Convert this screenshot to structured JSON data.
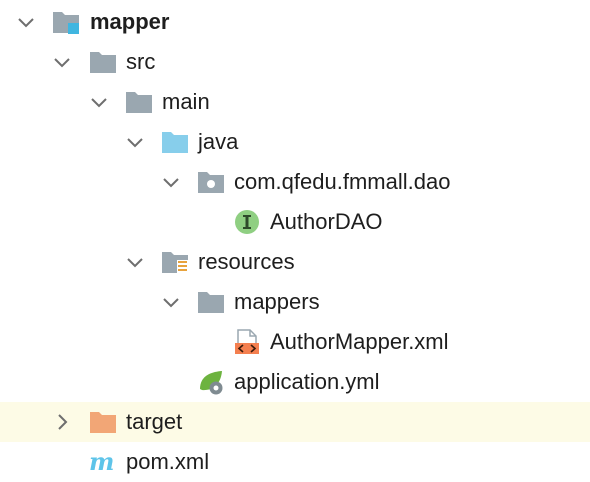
{
  "tree": {
    "module": "mapper",
    "src": "src",
    "main": "main",
    "java": "java",
    "package": "com.qfedu.fmmall.dao",
    "author_dao": "AuthorDAO",
    "resources": "resources",
    "mappers": "mappers",
    "author_mapper": "AuthorMapper.xml",
    "application": "application.yml",
    "target": "target",
    "pom": "pom.xml"
  },
  "icons": {
    "module": "module-folder-icon",
    "folder": "folder-icon",
    "source_root": "source-root-folder-icon",
    "package": "package-icon",
    "interface": "interface-icon",
    "resources_root": "resources-root-folder-icon",
    "xml": "xml-file-icon",
    "spring_yml": "spring-config-icon",
    "excluded": "excluded-folder-icon",
    "maven": "maven-pom-icon"
  },
  "colors": {
    "folder_gray": "#9aa7b0",
    "source_blue": "#87ceeb",
    "excluded_orange": "#f2a676",
    "interface_green": "#8fcf82",
    "xml_orange": "#f47f4f",
    "spring_green": "#6db33f",
    "maven_blue": "#5ec4e9",
    "selection_bg": "#fdfbe6"
  }
}
